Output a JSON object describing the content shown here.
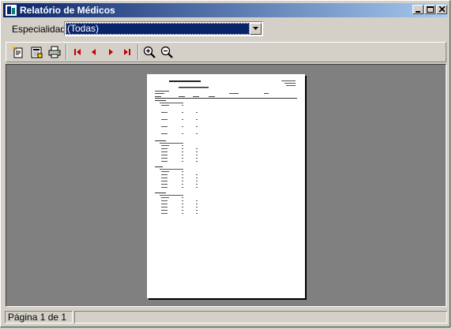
{
  "window": {
    "title": "Relatório de Médicos"
  },
  "filter": {
    "label": "Especialidade:",
    "selected": "(Todas)"
  },
  "toolbar": {
    "icons": [
      "page-setup-icon",
      "report-setup-icon",
      "print-icon",
      "first-page-icon",
      "previous-page-icon",
      "next-page-icon",
      "last-page-icon",
      "zoom-in-icon",
      "zoom-out-icon"
    ]
  },
  "status": {
    "page_info": "Página 1 de 1"
  },
  "colors": {
    "title_start": "#0a246a",
    "title_end": "#a6caf0",
    "preview_bg": "#808080",
    "nav_red": "#c00000"
  }
}
